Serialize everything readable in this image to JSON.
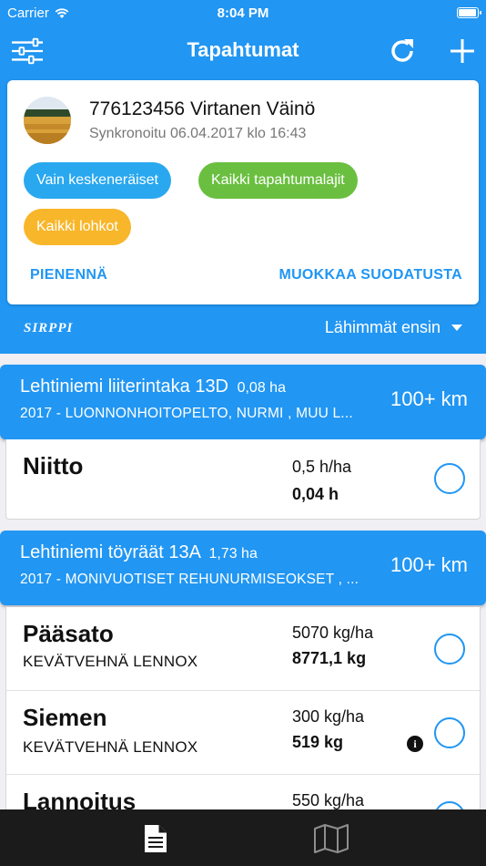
{
  "status": {
    "carrier": "Carrier",
    "time": "8:04 PM"
  },
  "nav": {
    "title": "Tapahtumat"
  },
  "profile": {
    "name": "776123456 Virtanen Väinö",
    "sync": "Synkronoitu 06.04.2017 klo 16:43"
  },
  "filters": {
    "chips": [
      "Vain keskeneräiset",
      "Kaikki tapahtumalajit",
      "Kaikki lohkot"
    ],
    "minimize": "PIENENNÄ",
    "edit": "MUOKKAA SUODATUSTA"
  },
  "brand": "SIRPPI",
  "sort": {
    "label": "Lähimmät ensin"
  },
  "groups": [
    {
      "title": "Lehtiniemi liiterintaka 13D",
      "area": "0,08 ha",
      "subtitle": "2017 - LUONNONHOITOPELTO, NURMI , MUU L...",
      "distance": "100+ km",
      "tasks": [
        {
          "name": "Niitto",
          "sub": "",
          "value1": "0,5 h/ha",
          "value2": "0,04 h",
          "info": false
        }
      ]
    },
    {
      "title": "Lehtiniemi töyräät 13A",
      "area": "1,73 ha",
      "subtitle": "2017 - MONIVUOTISET REHUNURMISEOKSET , ...",
      "distance": "100+ km",
      "tasks": [
        {
          "name": "Pääsato",
          "sub": "KEVÄTVEHNÄ LENNOX",
          "value1": "5070 kg/ha",
          "value2": "8771,1 kg",
          "info": false
        },
        {
          "name": "Siemen",
          "sub": "KEVÄTVEHNÄ LENNOX",
          "value1": "300 kg/ha",
          "value2": "519 kg",
          "info": true
        },
        {
          "name": "Lannoitus",
          "sub": "",
          "value1": "550 kg/ha",
          "value2": "",
          "info": false
        }
      ]
    }
  ],
  "tabs": [
    {
      "icon": "document-icon",
      "active": true
    },
    {
      "icon": "map-icon",
      "active": false
    }
  ],
  "colors": {
    "primary": "#2196f3",
    "chip_blue": "#29a8ef",
    "chip_green": "#6abf40",
    "chip_orange": "#f8b62a",
    "tabbar": "#1b1b1b"
  }
}
